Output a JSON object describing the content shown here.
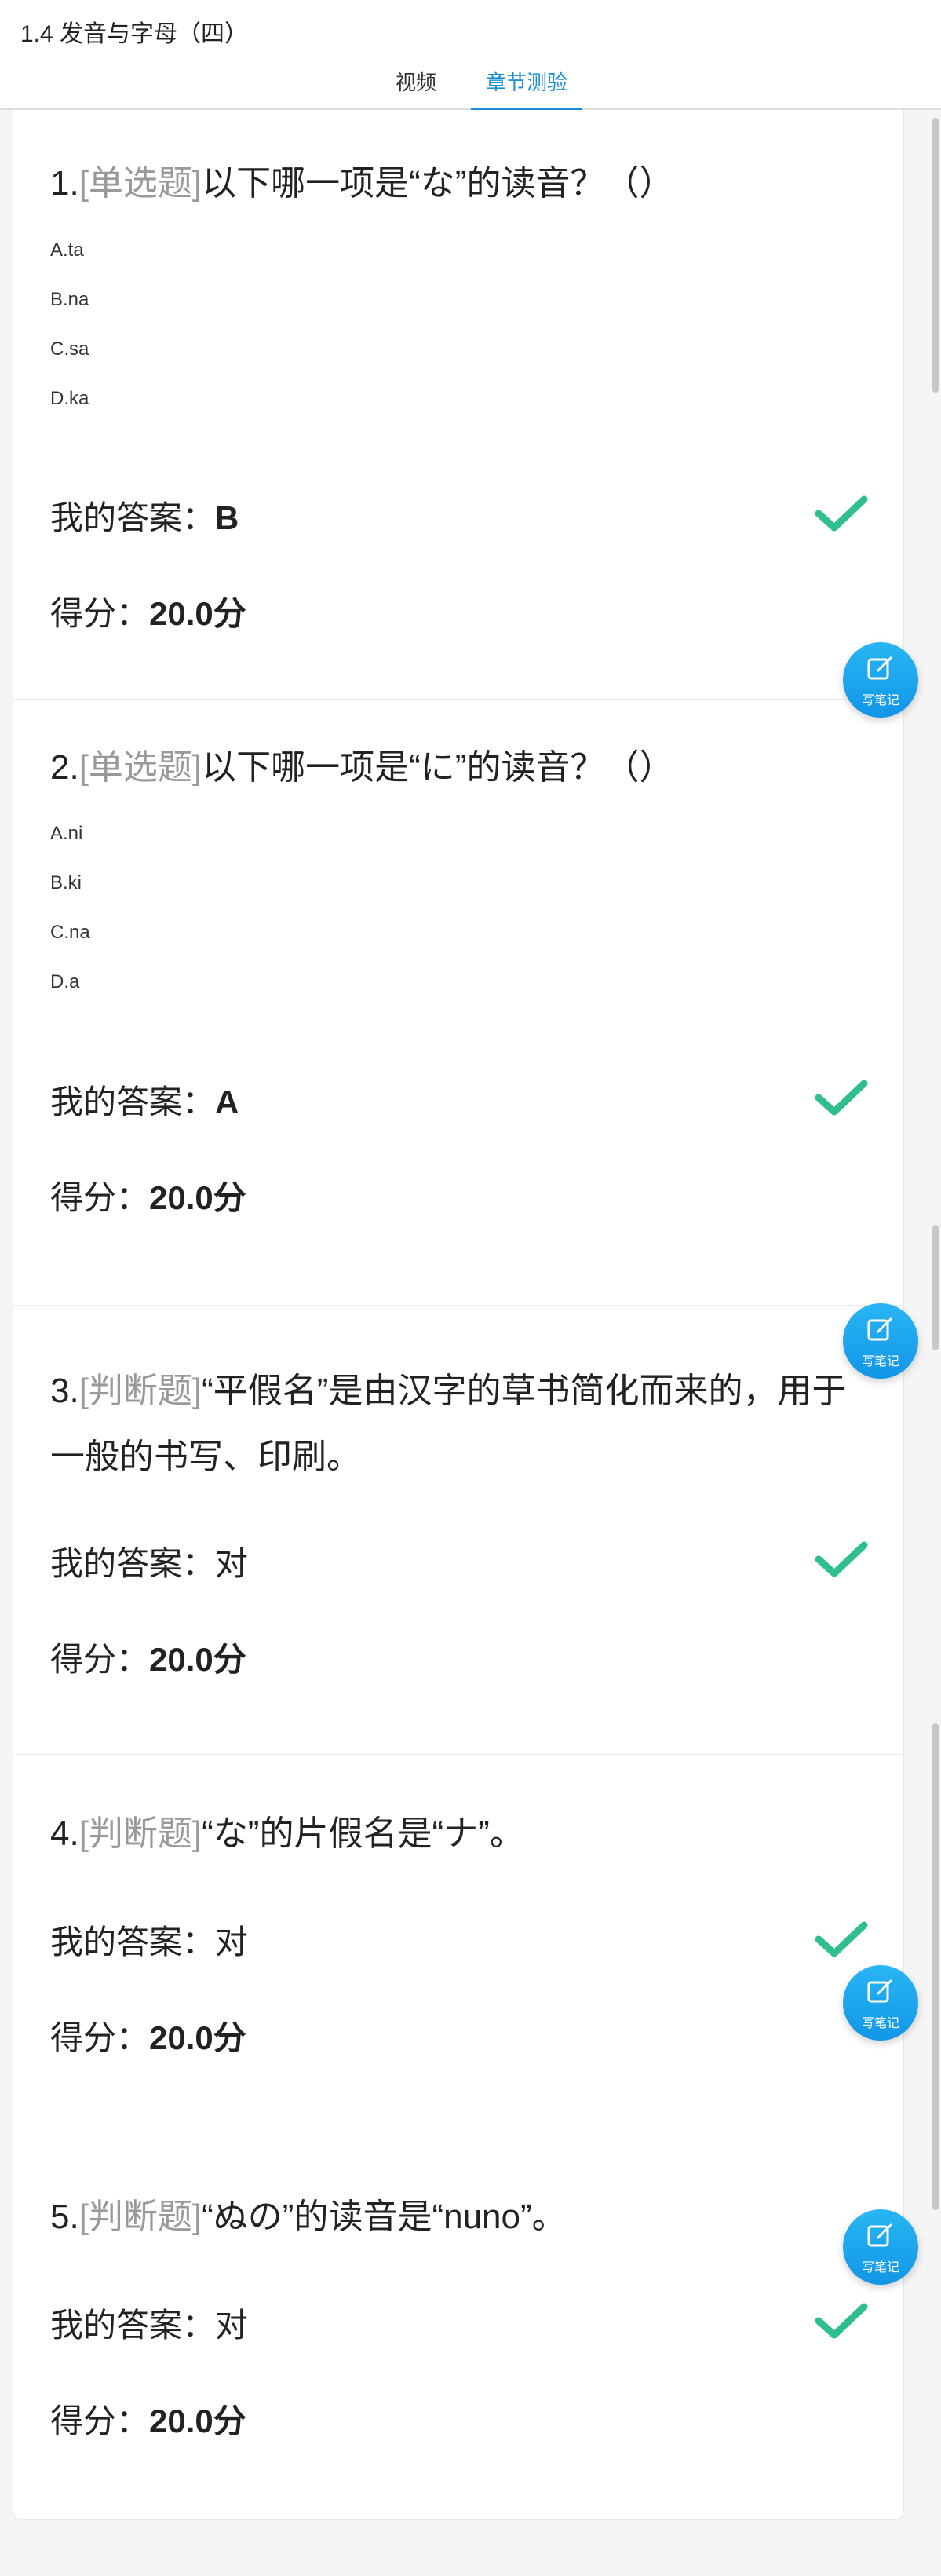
{
  "header": {
    "title": "1.4 发音与字母（四）",
    "tabs": [
      {
        "label": "视频"
      },
      {
        "label": "章节测验"
      }
    ]
  },
  "answer_prefix": "我的答案：",
  "score_prefix": "得分：",
  "note_button_label": "写笔记",
  "colors": {
    "accent": "#1a8fd6",
    "check": "#2fbf8f",
    "tag": "#999999"
  },
  "questions": [
    {
      "num": "1.",
      "tag": "[单选题]",
      "text": "以下哪一项是“な”的读音？（）",
      "options": [
        "A.ta",
        "B.na",
        "C.sa",
        "D.ka"
      ],
      "answer": "B",
      "score": "20.0分"
    },
    {
      "num": "2.",
      "tag": "[单选题]",
      "text": "以下哪一项是“に”的读音？（）",
      "options": [
        "A.ni",
        "B.ki",
        "C.na",
        "D.a"
      ],
      "answer": "A",
      "score": "20.0分"
    },
    {
      "num": "3.",
      "tag": "[判断题]",
      "text": "“平假名”是由汉字的草书简化而来的，用于一般的书写、印刷。",
      "answer": "对",
      "score": "20.0分"
    },
    {
      "num": "4.",
      "tag": "[判断题]",
      "text": "“な”的片假名是“ナ”。",
      "answer": "对",
      "score": "20.0分"
    },
    {
      "num": "5.",
      "tag": "[判断题]",
      "text": "“ぬの”的读音是“nuno”。",
      "answer": "对",
      "score": "20.0分"
    }
  ]
}
